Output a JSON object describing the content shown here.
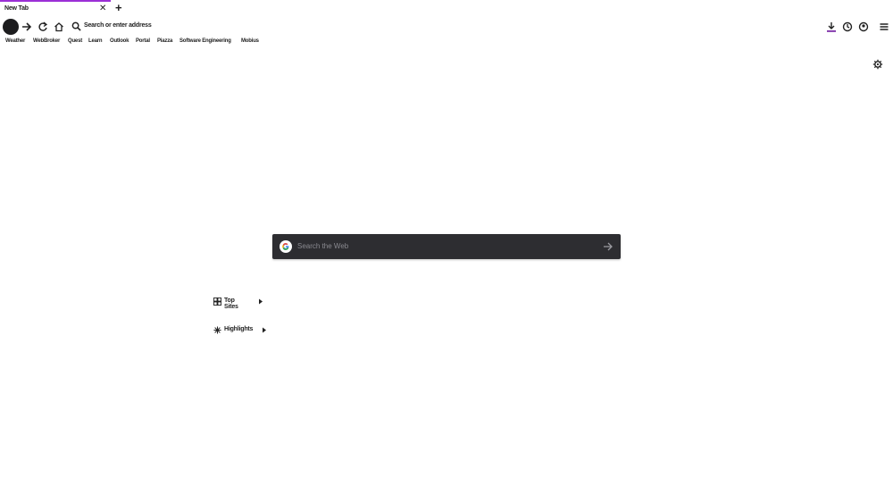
{
  "tabs": [
    {
      "title": "New Tab",
      "active": true
    }
  ],
  "tabstrip": {
    "new_tab_icon": "plus-icon",
    "close_icon": "close-icon"
  },
  "toolbar": {
    "url_placeholder": "Search or enter address",
    "icons": {
      "back": "back-icon",
      "forward": "forward-icon",
      "reload": "reload-icon",
      "home": "home-icon",
      "search": "search-icon",
      "downloads": "download-icon",
      "history": "history-icon",
      "account": "account-icon",
      "menu": "hamburger-menu-icon"
    }
  },
  "bookmarks": [
    "Weather",
    "WebBroker",
    "Quest",
    "Learn",
    "Outlook",
    "Portal",
    "Piazza",
    "Software Engineering",
    "Mobius"
  ],
  "newtab": {
    "search_placeholder": "Search the Web",
    "sections": [
      {
        "label": "Top Sites",
        "icon": "grid-icon",
        "collapsed_indicator": "caret-right-icon"
      },
      {
        "label": "Highlights",
        "icon": "sparkle-icon",
        "collapsed_indicator": "caret-right-icon"
      }
    ]
  },
  "colors": {
    "accent": "#9b2fd6",
    "download_accent": "#7d2fa8",
    "search_bg": "#2d2d31",
    "page_bg": "#ffffff"
  }
}
